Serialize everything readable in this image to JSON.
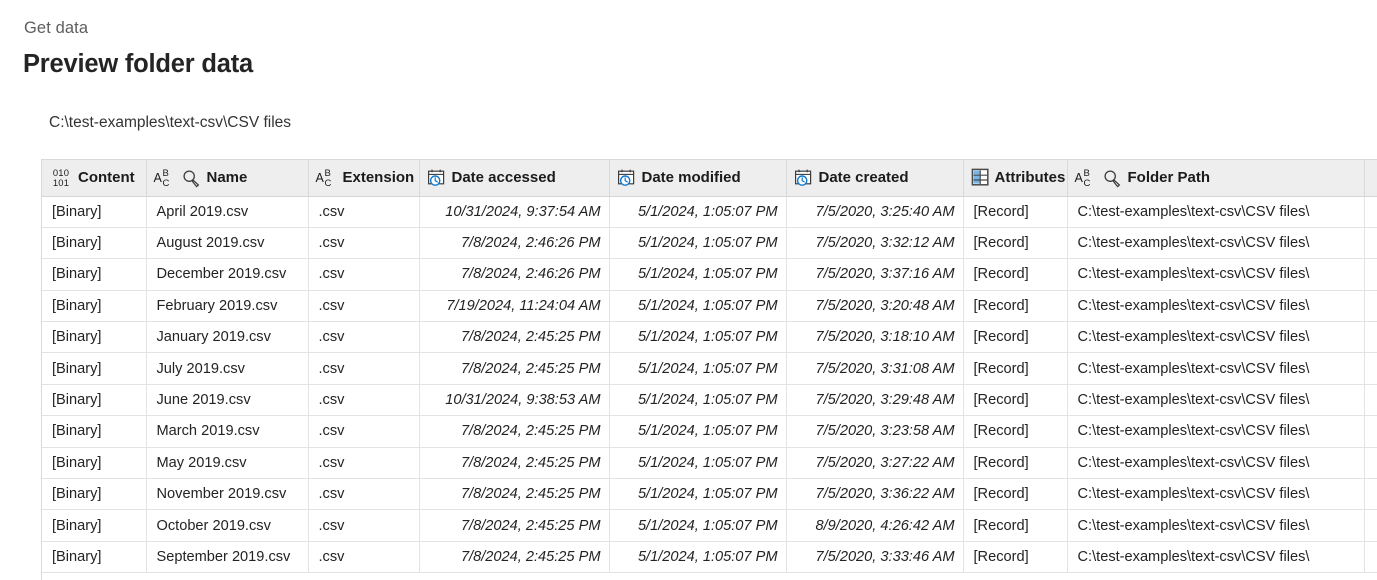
{
  "breadcrumb": "Get data",
  "page_title": "Preview folder data",
  "folder_path": "C:\\test-examples\\text-csv\\CSV files",
  "colors": {
    "link_teal": "#157b6e",
    "header_bg": "#eeeeee",
    "grid_line": "#e3e3e3",
    "title": "#242424",
    "icon_blue": "#0f79d0"
  },
  "table": {
    "columns": [
      {
        "key": "content",
        "label": "Content",
        "icon": "binary-icon",
        "type": "binary"
      },
      {
        "key": "name",
        "label": "Name",
        "icon": "abc-search-icon",
        "type": "text"
      },
      {
        "key": "extension",
        "label": "Extension",
        "icon": "abc-icon",
        "type": "text"
      },
      {
        "key": "accessed",
        "label": "Date accessed",
        "icon": "calendar-clock-icon",
        "type": "datetime"
      },
      {
        "key": "modified",
        "label": "Date modified",
        "icon": "calendar-clock-icon",
        "type": "datetime"
      },
      {
        "key": "created",
        "label": "Date created",
        "icon": "calendar-clock-icon",
        "type": "datetime"
      },
      {
        "key": "attributes",
        "label": "Attributes",
        "icon": "record-table-icon",
        "type": "record"
      },
      {
        "key": "folder",
        "label": "Folder Path",
        "icon": "abc-search-icon",
        "type": "text"
      }
    ],
    "rows": [
      {
        "content": "[Binary]",
        "name": "April 2019.csv",
        "extension": ".csv",
        "accessed": "10/31/2024, 9:37:54 AM",
        "modified": "5/1/2024, 1:05:07 PM",
        "created": "7/5/2020, 3:25:40 AM",
        "attributes": "[Record]",
        "folder": "C:\\test-examples\\text-csv\\CSV files\\"
      },
      {
        "content": "[Binary]",
        "name": "August 2019.csv",
        "extension": ".csv",
        "accessed": "7/8/2024, 2:46:26 PM",
        "modified": "5/1/2024, 1:05:07 PM",
        "created": "7/5/2020, 3:32:12 AM",
        "attributes": "[Record]",
        "folder": "C:\\test-examples\\text-csv\\CSV files\\"
      },
      {
        "content": "[Binary]",
        "name": "December 2019.csv",
        "extension": ".csv",
        "accessed": "7/8/2024, 2:46:26 PM",
        "modified": "5/1/2024, 1:05:07 PM",
        "created": "7/5/2020, 3:37:16 AM",
        "attributes": "[Record]",
        "folder": "C:\\test-examples\\text-csv\\CSV files\\"
      },
      {
        "content": "[Binary]",
        "name": "February 2019.csv",
        "extension": ".csv",
        "accessed": "7/19/2024, 11:24:04 AM",
        "modified": "5/1/2024, 1:05:07 PM",
        "created": "7/5/2020, 3:20:48 AM",
        "attributes": "[Record]",
        "folder": "C:\\test-examples\\text-csv\\CSV files\\"
      },
      {
        "content": "[Binary]",
        "name": "January 2019.csv",
        "extension": ".csv",
        "accessed": "7/8/2024, 2:45:25 PM",
        "modified": "5/1/2024, 1:05:07 PM",
        "created": "7/5/2020, 3:18:10 AM",
        "attributes": "[Record]",
        "folder": "C:\\test-examples\\text-csv\\CSV files\\"
      },
      {
        "content": "[Binary]",
        "name": "July 2019.csv",
        "extension": ".csv",
        "accessed": "7/8/2024, 2:45:25 PM",
        "modified": "5/1/2024, 1:05:07 PM",
        "created": "7/5/2020, 3:31:08 AM",
        "attributes": "[Record]",
        "folder": "C:\\test-examples\\text-csv\\CSV files\\"
      },
      {
        "content": "[Binary]",
        "name": "June 2019.csv",
        "extension": ".csv",
        "accessed": "10/31/2024, 9:38:53 AM",
        "modified": "5/1/2024, 1:05:07 PM",
        "created": "7/5/2020, 3:29:48 AM",
        "attributes": "[Record]",
        "folder": "C:\\test-examples\\text-csv\\CSV files\\"
      },
      {
        "content": "[Binary]",
        "name": "March 2019.csv",
        "extension": ".csv",
        "accessed": "7/8/2024, 2:45:25 PM",
        "modified": "5/1/2024, 1:05:07 PM",
        "created": "7/5/2020, 3:23:58 AM",
        "attributes": "[Record]",
        "folder": "C:\\test-examples\\text-csv\\CSV files\\"
      },
      {
        "content": "[Binary]",
        "name": "May 2019.csv",
        "extension": ".csv",
        "accessed": "7/8/2024, 2:45:25 PM",
        "modified": "5/1/2024, 1:05:07 PM",
        "created": "7/5/2020, 3:27:22 AM",
        "attributes": "[Record]",
        "folder": "C:\\test-examples\\text-csv\\CSV files\\"
      },
      {
        "content": "[Binary]",
        "name": "November 2019.csv",
        "extension": ".csv",
        "accessed": "7/8/2024, 2:45:25 PM",
        "modified": "5/1/2024, 1:05:07 PM",
        "created": "7/5/2020, 3:36:22 AM",
        "attributes": "[Record]",
        "folder": "C:\\test-examples\\text-csv\\CSV files\\"
      },
      {
        "content": "[Binary]",
        "name": "October 2019.csv",
        "extension": ".csv",
        "accessed": "7/8/2024, 2:45:25 PM",
        "modified": "5/1/2024, 1:05:07 PM",
        "created": "8/9/2020, 4:26:42 AM",
        "attributes": "[Record]",
        "folder": "C:\\test-examples\\text-csv\\CSV files\\"
      },
      {
        "content": "[Binary]",
        "name": "September 2019.csv",
        "extension": ".csv",
        "accessed": "7/8/2024, 2:45:25 PM",
        "modified": "5/1/2024, 1:05:07 PM",
        "created": "7/5/2020, 3:33:46 AM",
        "attributes": "[Record]",
        "folder": "C:\\test-examples\\text-csv\\CSV files\\"
      }
    ]
  },
  "icon_glyphs": {
    "binary_top": "010",
    "binary_bottom": "101",
    "abc_a": "A",
    "abc_b": "B",
    "abc_c": "C"
  }
}
